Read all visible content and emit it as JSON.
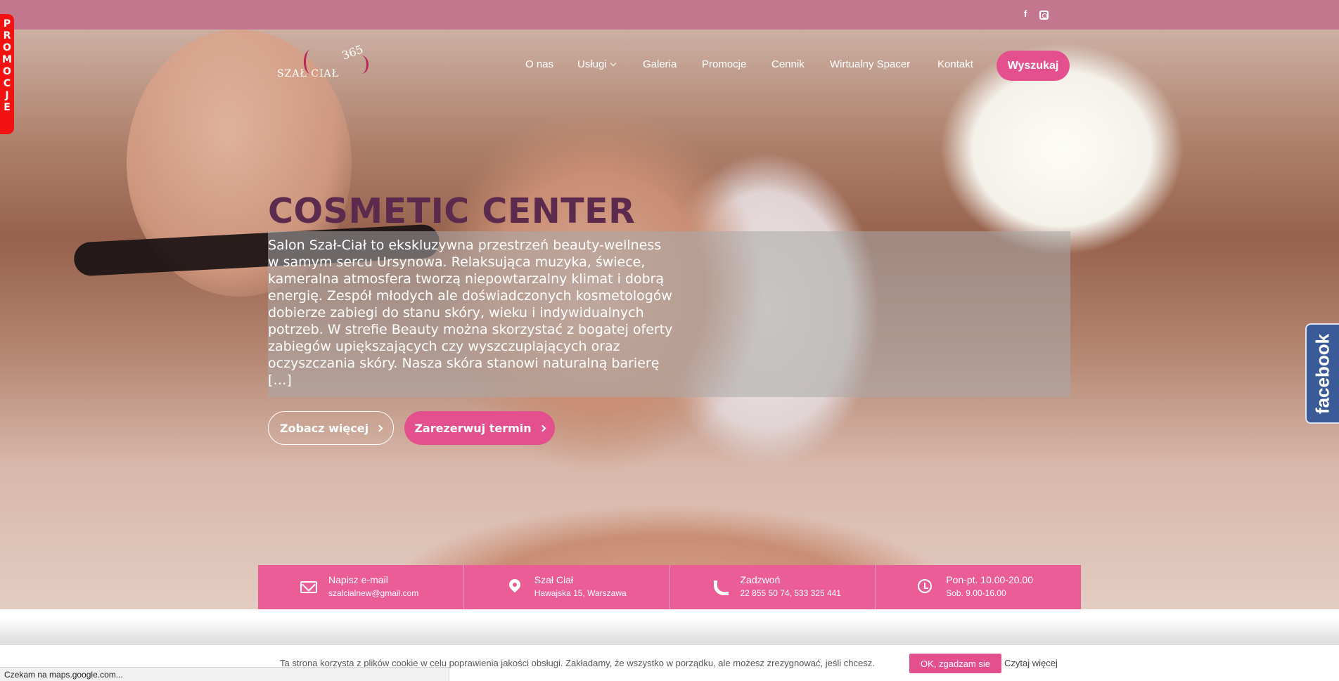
{
  "topbar": {
    "social": [
      {
        "icon": "facebook-icon",
        "label": "f"
      },
      {
        "icon": "instagram-icon",
        "label": ""
      }
    ]
  },
  "logo": {
    "wordmark": "SZAŁ CIAŁ",
    "number": "365"
  },
  "nav": {
    "items": [
      "O nas",
      "Usługi",
      "Galeria",
      "Promocje",
      "Cennik",
      "Wirtualny Spacer",
      "Kontakt"
    ],
    "search_label": "Wyszukaj"
  },
  "promo_tab": {
    "letters": [
      "P",
      "R",
      "O",
      "M",
      "O",
      "C",
      "J",
      "E"
    ]
  },
  "facebook_tab": {
    "label": "facebook"
  },
  "hero": {
    "title": "COSMETIC CENTER",
    "text": "Salon Szał-Ciał to ekskluzywna przestrzeń beauty-wellness w samym sercu Ursynowa. Relaksująca muzyka, świece, kameralna atmosfera tworzą niepowtarzalny klimat i dobrą energię. Zespół młodych ale doświadczonych kosmetologów dobierze zabiegi do stanu skóry, wieku i indywidualnych potrzeb. W strefie Beauty można skorzystać z bogatej oferty zabiegów upiększających czy wyszczuplających oraz oczyszczania skóry. Nasza skóra stanowi naturalną barierę […]",
    "more_label": "Zobacz więcej",
    "reserve_label": "Zarezerwuj termin"
  },
  "contact": [
    {
      "icon": "mail-icon",
      "title": "Napisz e-mail",
      "detail": "szalcialnew@gmail.com"
    },
    {
      "icon": "location-pin-icon",
      "title": "Szał Ciał",
      "detail": "Hawajska 15, Warszawa"
    },
    {
      "icon": "phone-icon",
      "title": "Zadzwoń",
      "detail": "22 855 50 74, 533 325 441"
    },
    {
      "icon": "clock-icon",
      "title": "Pon-pt. 10.00-20.00",
      "detail": "Sob. 9.00-16.00"
    }
  ],
  "cookie": {
    "text": "Ta strona korzysta z plików cookie w celu poprawienia jakości obsługi. Zakładamy, że wszystko w porządku, ale możesz zrezygnować, jeśli chcesz.",
    "ok_label": "OK, zgadzam sie",
    "more_label": "Czytaj więcej"
  },
  "status_bar": {
    "text": "Czekam na maps.google.com..."
  },
  "colors": {
    "accent": "#e4508e",
    "topbar": "#c2778f",
    "title": "#5c2a4c",
    "facebook": "#3b5a98",
    "promo": "#f21212"
  }
}
